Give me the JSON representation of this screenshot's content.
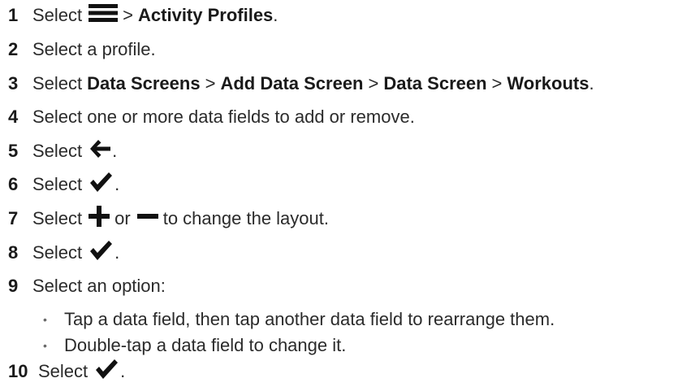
{
  "steps": [
    {
      "num": "1",
      "pre": "Select",
      "sep": ">",
      "bold1": "Activity Profiles",
      "post": "."
    },
    {
      "num": "2",
      "text": "Select a profile."
    },
    {
      "num": "3",
      "pre": "Select",
      "b1": "Data Screens",
      "b2": "Add Data Screen",
      "b3": "Data Screen",
      "b4": "Workouts",
      "sep": ">",
      "post": "."
    },
    {
      "num": "4",
      "text": "Select one or more data fields to add or remove."
    },
    {
      "num": "5",
      "pre": "Select",
      "post": "."
    },
    {
      "num": "6",
      "pre": "Select",
      "post": "."
    },
    {
      "num": "7",
      "pre": "Select",
      "mid": "or",
      "post": "to change the layout."
    },
    {
      "num": "8",
      "pre": "Select",
      "post": "."
    },
    {
      "num": "9",
      "text": "Select an option:"
    },
    {
      "num": "10",
      "pre": "Select",
      "post": "."
    }
  ],
  "options": [
    {
      "bullet": "•",
      "text": "Tap a data field, then tap another data field to rearrange them."
    },
    {
      "bullet": "•",
      "text": "Double-tap a data field to change it."
    }
  ],
  "icons": {
    "menu": "menu-icon",
    "back": "back-arrow-icon",
    "check": "checkmark-icon",
    "plus": "plus-icon",
    "minus": "minus-icon"
  },
  "colors": {
    "text": "#2b2b2b",
    "icon": "#111111"
  }
}
